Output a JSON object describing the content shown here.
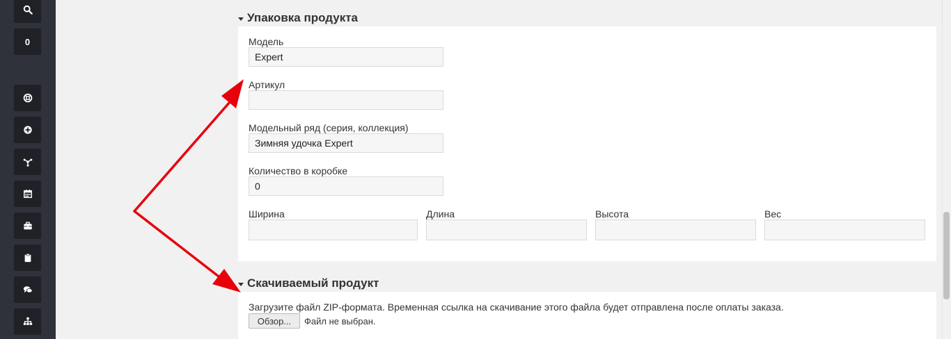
{
  "sidebar": {
    "search_icon": "search-icon",
    "counter": "0",
    "icons": [
      "lifebuoy-icon",
      "plus-circle-icon",
      "share-icon",
      "calendar-icon",
      "briefcase-icon",
      "clipboard-icon",
      "comments-icon",
      "sitemap-icon"
    ]
  },
  "packaging": {
    "title": "Упаковка продукта",
    "model_label": "Модель",
    "model_value": "Expert",
    "sku_label": "Артикул",
    "sku_value": "",
    "series_label": "Модельный ряд (серия, коллекция)",
    "series_value": "Зимняя удочка Expert",
    "qty_label": "Количество в коробке",
    "qty_value": "0",
    "width_label": "Ширина",
    "width_value": "",
    "length_label": "Длина",
    "length_value": "",
    "height_label": "Высота",
    "height_value": "",
    "weight_label": "Вес",
    "weight_value": ""
  },
  "download": {
    "title": "Скачиваемый продукт",
    "help": "Загрузите файл ZIP-формата. Временная ссылка на скачивание этого файла будет отправлена после оплаты заказа.",
    "browse_label": "Обзор...",
    "no_file": "Файл не выбран."
  },
  "colors": {
    "sidebar_bg": "#2f323a",
    "button_bg": "#1f2127",
    "arrow": "#e8000b"
  }
}
